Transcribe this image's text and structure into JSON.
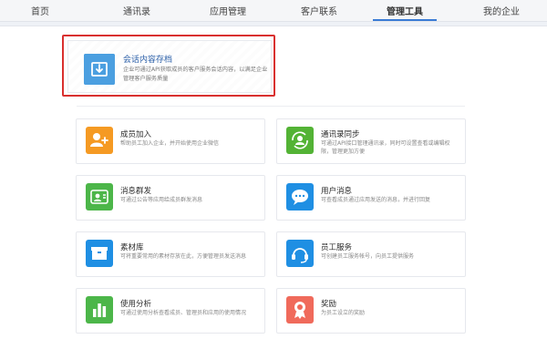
{
  "nav": {
    "items": [
      {
        "label": "首页"
      },
      {
        "label": "通讯录"
      },
      {
        "label": "应用管理"
      },
      {
        "label": "客户联系"
      },
      {
        "label": "管理工具",
        "active": true
      },
      {
        "label": "我的企业"
      }
    ],
    "accent": "#3a7bd5"
  },
  "featured": {
    "title": "会话内容存档",
    "desc": "企业可通过API获取成员的客户服务会话内容，以满足企业管理客户服务质量",
    "icon": "archive-download-icon",
    "color": "#4b9fe0",
    "highlight_color": "#d9302f"
  },
  "tools": [
    {
      "title": "成员加入",
      "desc": "帮助员工加入企业，并开始使用企业微信",
      "icon": "member-join-icon",
      "color": "#f59a23"
    },
    {
      "title": "通讯录同步",
      "desc": "可通过API接口管理通讯录，同时可设置查看或编辑权限，管理更加方便",
      "icon": "contacts-sync-icon",
      "color": "#53b335"
    },
    {
      "title": "消息群发",
      "desc": "可通过公告等应用给成员群发消息",
      "icon": "broadcast-icon",
      "color": "#4cb649"
    },
    {
      "title": "用户消息",
      "desc": "可查看成员通过应用发送的消息，并进行回复",
      "icon": "chat-bubble-icon",
      "color": "#1f8fe3"
    },
    {
      "title": "素材库",
      "desc": "可将重要常用的素材存放在此，方便管理员发送消息",
      "icon": "material-box-icon",
      "color": "#1f8fe3"
    },
    {
      "title": "员工服务",
      "desc": "可创建员工服务帐号，向员工提供服务",
      "icon": "headset-icon",
      "color": "#1f8fe3"
    },
    {
      "title": "使用分析",
      "desc": "可通过使用分析查看成员、管理员和应用的使用情况",
      "icon": "bar-chart-icon",
      "color": "#4cb649"
    },
    {
      "title": "奖励",
      "desc": "为员工设立的奖励",
      "icon": "award-medal-icon",
      "color": "#f06a5b"
    }
  ]
}
